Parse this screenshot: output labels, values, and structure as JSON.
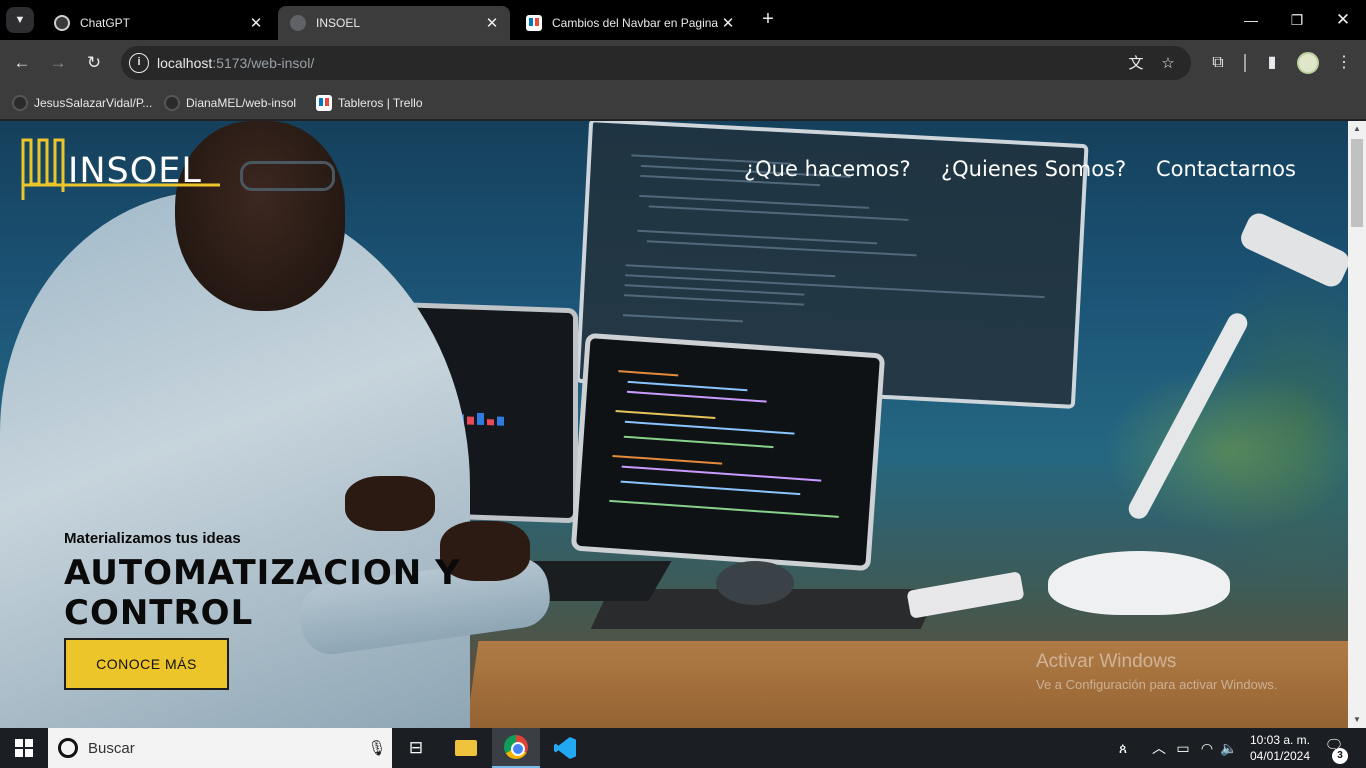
{
  "browser": {
    "tabs": [
      {
        "label": "ChatGPT",
        "active": false
      },
      {
        "label": "INSOEL",
        "active": true
      },
      {
        "label": "Cambios del Navbar en Pagina",
        "active": false
      }
    ],
    "url_host": "localhost",
    "url_rest": ":5173/web-insol/",
    "bookmarks": [
      {
        "label": "JesusSalazarVidal/P..."
      },
      {
        "label": "DianaMEL/web-insol"
      },
      {
        "label": "Tableros | Trello"
      }
    ],
    "icons": {
      "translate": "translate-icon",
      "bookmark_star": "star-icon",
      "extensions": "puzzle-icon",
      "side_panel": "side-panel-icon",
      "menu": "kebab-menu-icon"
    }
  },
  "site": {
    "logo_text": "INSOEL",
    "logo_color": "#ecc52a",
    "nav": [
      "¿Que hacemos?",
      "¿Quienes Somos?",
      "Contactarnos"
    ],
    "tagline": "Materializamos tus ideas",
    "hero_title_line1": "AUTOMATIZACION Y",
    "hero_title_line2": "CONTROL",
    "cta_label": "CONOCE MÁS",
    "cta_color": "#ecc52a"
  },
  "watermark": {
    "title": "Activar Windows",
    "subtitle": "Ve a Configuración para activar Windows."
  },
  "taskbar": {
    "search_placeholder": "Buscar",
    "time": "10:03 a. m.",
    "date": "04/01/2024",
    "notification_count": "3"
  }
}
